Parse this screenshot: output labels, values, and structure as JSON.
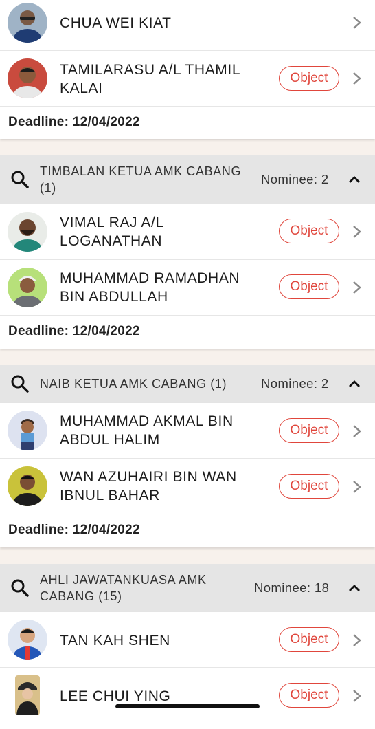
{
  "colors": {
    "accent": "#e0463c",
    "header_bg": "#e5e5e5",
    "page_bg": "#f7f1ec"
  },
  "groups": [
    {
      "title": "",
      "nominee": "",
      "candidates": [
        {
          "name": "CHUA WEI KIAT",
          "has_object": false,
          "avatar": "person-avatar"
        },
        {
          "name_line1": "TAMILARASU A/L THAMIL",
          "name_line2": "KALAI",
          "object_label": "Object",
          "avatar": "person-avatar"
        }
      ],
      "deadline": "Deadline: 12/04/2022"
    },
    {
      "title_line1": "TIMBALAN KETUA AMK CABANG",
      "title_line2": "(1)",
      "nominee": "Nominee: 2",
      "candidates": [
        {
          "name_line1": "VIMAL RAJ A/L",
          "name_line2": "LOGANATHAN",
          "object_label": "Object"
        },
        {
          "name_line1": "MUHAMMAD RAMADHAN",
          "name_line2": "BIN ABDULLAH",
          "object_label": "Object"
        }
      ],
      "deadline": "Deadline: 12/04/2022"
    },
    {
      "title_line1": "NAIB KETUA AMK CABANG (1)",
      "nominee": "Nominee: 2",
      "candidates": [
        {
          "name_line1": "MUHAMMAD AKMAL BIN",
          "name_line2": "ABDUL HALIM",
          "object_label": "Object"
        },
        {
          "name_line1": "WAN AZUHAIRI BIN WAN",
          "name_line2": "IBNUL BAHAR",
          "object_label": "Object"
        }
      ],
      "deadline": "Deadline: 12/04/2022"
    },
    {
      "title_line1": "AHLI JAWATANKUASA AMK",
      "title_line2": "CABANG (15)",
      "nominee": "Nominee: 18",
      "candidates": [
        {
          "name": "TAN KAH SHEN",
          "object_label": "Object"
        },
        {
          "name": "LEE CHUI YING",
          "object_label": "Object"
        }
      ]
    }
  ]
}
